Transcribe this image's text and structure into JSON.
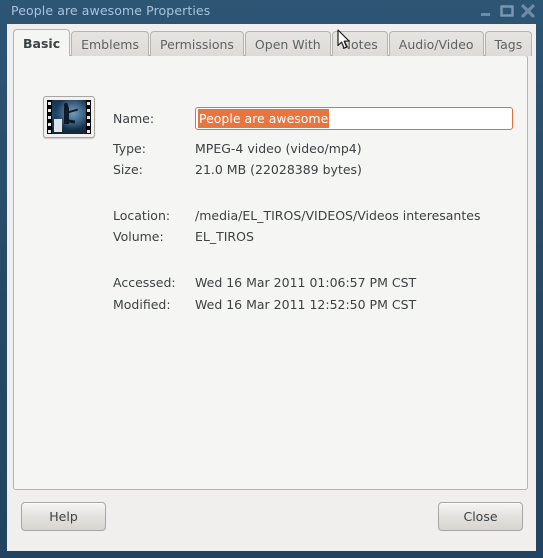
{
  "window": {
    "title": "People are awesome Properties",
    "controls": [
      {
        "name": "minimize",
        "glyph": "_"
      },
      {
        "name": "maximize",
        "glyph": "□"
      },
      {
        "name": "close",
        "glyph": "✖"
      }
    ],
    "frame_color": "#274a66",
    "title_color": "#a9c4da"
  },
  "tabs": [
    {
      "label": "Basic",
      "active": true
    },
    {
      "label": "Emblems",
      "active": false
    },
    {
      "label": "Permissions",
      "active": false
    },
    {
      "label": "Open With",
      "active": false
    },
    {
      "label": "Notes",
      "active": false
    },
    {
      "label": "Audio/Video",
      "active": false
    },
    {
      "label": "Tags",
      "active": false
    }
  ],
  "basic": {
    "icon": "video-file-thumbnail",
    "name": {
      "label": "Name:",
      "value": "People are awesome",
      "selected": true,
      "selection_color": "#e8743f",
      "border_color": "#e1703a"
    },
    "type": {
      "label": "Type:",
      "value": "MPEG-4 video (video/mp4)"
    },
    "size": {
      "label": "Size:",
      "value": "21.0 MB (22028389 bytes)"
    },
    "location": {
      "label": "Location:",
      "value": "/media/EL_TIROS/VIDEOS/Videos interesantes"
    },
    "volume": {
      "label": "Volume:",
      "value": "EL_TIROS"
    },
    "accessed": {
      "label": "Accessed:",
      "value": "Wed 16 Mar 2011 01:06:57 PM CST"
    },
    "modified": {
      "label": "Modified:",
      "value": "Wed 16 Mar 2011 12:52:50 PM CST"
    }
  },
  "actions": {
    "help_label": "Help",
    "close_label": "Close"
  }
}
